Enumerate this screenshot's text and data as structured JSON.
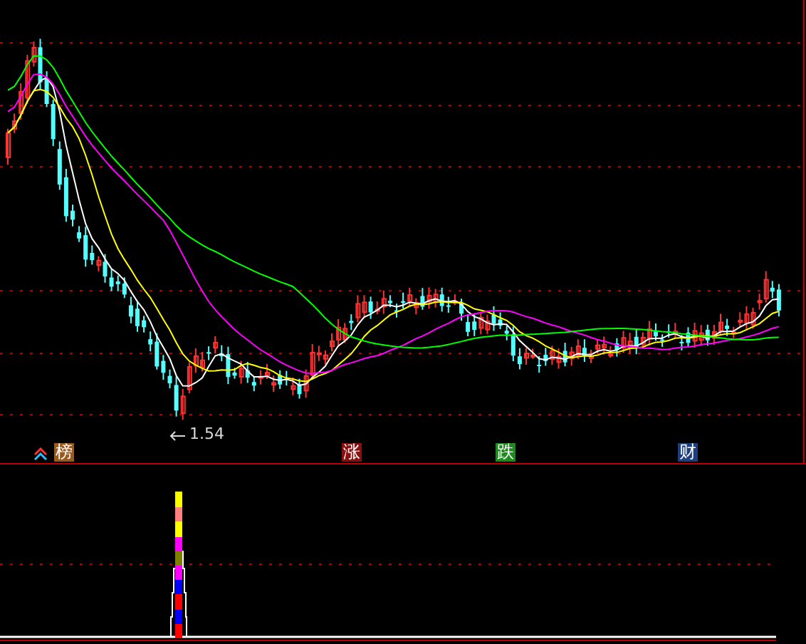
{
  "main_chart": {
    "low_marker": "1.54",
    "markers": [
      {
        "kind": "ranking",
        "label": "榜",
        "color": "#9a5a1e"
      },
      {
        "kind": "plain",
        "label": "涨",
        "color": "#8a1010"
      },
      {
        "kind": "plain",
        "label": "跌",
        "color": "#1c8a1c"
      },
      {
        "kind": "plain",
        "label": "财",
        "color": "#1d3f7e"
      }
    ]
  }
}
